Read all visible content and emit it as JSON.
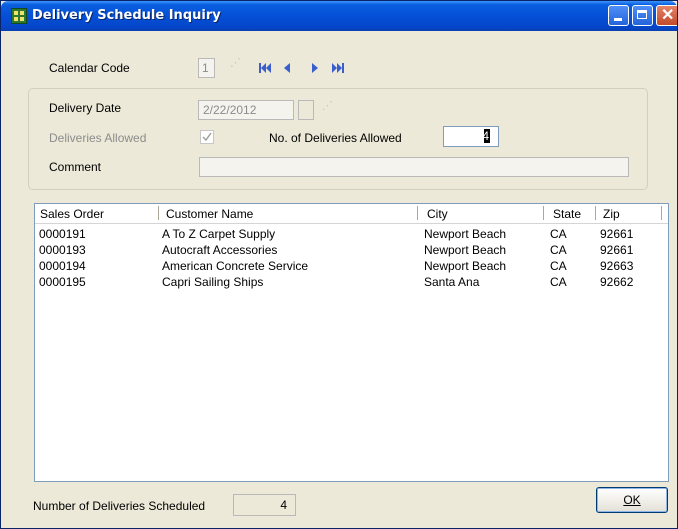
{
  "window": {
    "title": "Delivery Schedule Inquiry"
  },
  "calendar": {
    "label": "Calendar Code",
    "value": "1"
  },
  "delivery": {
    "date_label": "Delivery Date",
    "date_value": "2/22/2012",
    "allowed_label": "Deliveries Allowed",
    "allowed_checked": true,
    "count_label": "No. of Deliveries Allowed",
    "count_value": "4",
    "comment_label": "Comment",
    "comment_value": ""
  },
  "grid": {
    "columns": [
      "Sales Order",
      "Customer Name",
      "City",
      "State",
      "Zip"
    ],
    "rows": [
      [
        "0000191",
        "A To Z Carpet Supply",
        "Newport Beach",
        "CA",
        "92661"
      ],
      [
        "0000193",
        "Autocraft Accessories",
        "Newport Beach",
        "CA",
        "92661"
      ],
      [
        "0000194",
        "American Concrete Service",
        "Newport Beach",
        "CA",
        "92663"
      ],
      [
        "0000195",
        "Capri Sailing Ships",
        "Santa Ana",
        "CA",
        "92662"
      ]
    ]
  },
  "footer": {
    "scheduled_label": "Number of Deliveries Scheduled",
    "scheduled_value": "4",
    "ok_label": "OK"
  },
  "colors": {
    "titlebar": "#0550d7",
    "face": "#ece9d8",
    "close": "#c44a2a"
  }
}
